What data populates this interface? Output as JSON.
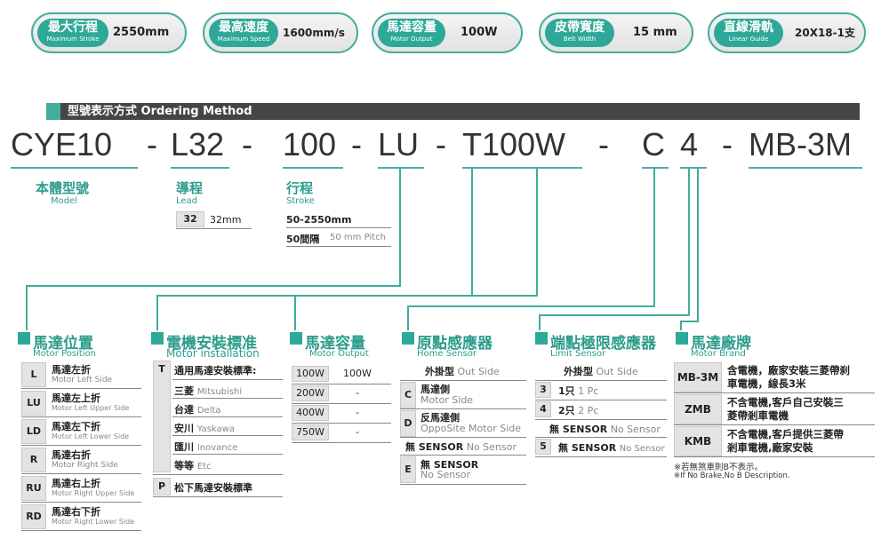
{
  "specs": [
    {
      "cn": "最大行程",
      "en": "Maximum Stroke",
      "value": "2550mm"
    },
    {
      "cn": "最高速度",
      "en": "Maximum Speed",
      "value": "1600mm/s"
    },
    {
      "cn": "馬達容量",
      "en": "Motor Output",
      "value": "100W"
    },
    {
      "cn": "皮帶寬度",
      "en": "Belt Width",
      "value": "15 mm"
    },
    {
      "cn": "直線滑軌",
      "en": "Linear Guide",
      "value": "20X18-1支"
    }
  ],
  "ordering": {
    "title": "型號表示方式 Ordering Method",
    "code": [
      "CYE10",
      "-",
      "L32",
      "-",
      "100",
      "-",
      "LU",
      "-",
      "T100W",
      "-",
      "C",
      "4",
      "-",
      "MB-3M"
    ]
  },
  "model": {
    "cn": "本體型號",
    "en": "Model"
  },
  "lead": {
    "cn": "導程",
    "en": "Lead",
    "key": "32",
    "value": "32mm"
  },
  "stroke": {
    "cn": "行程",
    "en": "Stroke",
    "row1": "50-2550mm",
    "row2_bold": "50間隔",
    "row2_grey": "50 mm Pitch"
  },
  "motor_position": {
    "cn": "馬達位置",
    "en": "Motor Position",
    "rows": [
      {
        "key": "L",
        "cn": "馬達左折",
        "en": "Motor Left Side"
      },
      {
        "key": "LU",
        "cn": "馬達左上折",
        "en": "Motor Left Upper Side"
      },
      {
        "key": "LD",
        "cn": "馬達左下折",
        "en": "Motor Left Lower Side"
      },
      {
        "key": "R",
        "cn": "馬達右折",
        "en": "Motor Right Side"
      },
      {
        "key": "RU",
        "cn": "馬達右上折",
        "en": "Motor Right Upper Side"
      },
      {
        "key": "RD",
        "cn": "馬達右下折",
        "en": "Motor Right Lower Side"
      }
    ]
  },
  "motor_installation": {
    "cn": "電機安裝標准",
    "en": "Motor installation",
    "t_key": "T",
    "t_rows": [
      {
        "cn": "通用馬達安裝標準:",
        "en": ""
      },
      {
        "cn": "三菱",
        "en": "Mitsubishi"
      },
      {
        "cn": "台達",
        "en": "Delta"
      },
      {
        "cn": "安川",
        "en": "Yaskawa"
      },
      {
        "cn": "匯川",
        "en": "Inovance"
      },
      {
        "cn": "等等",
        "en": "Etc"
      }
    ],
    "p_key": "P",
    "p_text": "松下馬達安裝標準"
  },
  "motor_output": {
    "cn": "馬達容量",
    "en": "Motor Output",
    "rows": [
      [
        "100W",
        "100W"
      ],
      [
        "200W",
        "-"
      ],
      [
        "400W",
        "-"
      ],
      [
        "750W",
        "-"
      ]
    ]
  },
  "home_sensor": {
    "cn": "原點感應器",
    "en": "Home Sensor",
    "head_bold": "外掛型",
    "head_grey": "Out Side",
    "c_key": "C",
    "c_cn": "馬達側",
    "c_en": "Motor Side",
    "d_key": "D",
    "d_cn": "反馬達側",
    "d_en": "OppoSite Motor Side",
    "none_bold": "無 SENSOR",
    "none_grey": "No Sensor",
    "e_key": "E",
    "e_cn": "無 SENSOR",
    "e_en": "No Sensor"
  },
  "limit_sensor": {
    "cn": "端點極限感應器",
    "en": "Limit Sensor",
    "head_bold": "外掛型",
    "head_grey": "Out Side",
    "rows": [
      {
        "key": "3",
        "bold": "1只",
        "grey": "1 Pc"
      },
      {
        "key": "4",
        "bold": "2只",
        "grey": "2 Pc"
      }
    ],
    "none_bold": "無 SENSOR",
    "none_grey": "No Sensor",
    "five_key": "5",
    "five_bold": "無 SENSOR",
    "five_grey": "No Sensor"
  },
  "motor_brand": {
    "cn": "馬達廠牌",
    "en": "Motor Brand",
    "rows": [
      {
        "key": "MB-3M",
        "text1": "含電機，廠家安裝三菱帶刹",
        "text2": "車電機，線長3米"
      },
      {
        "key": "ZMB",
        "text1": "不含電機,客戶自己安裝三",
        "text2": "菱帶剎車電機"
      },
      {
        "key": "KMB",
        "text1": "不含電機,客戶提供三菱帶",
        "text2": "剎車電機,廠家安裝"
      }
    ],
    "note1": "※若無煞車則B不表示。",
    "note2": "※If No Brake,No B Description."
  },
  "colors": {
    "accent": "#2ea898",
    "bar": "#454545"
  }
}
